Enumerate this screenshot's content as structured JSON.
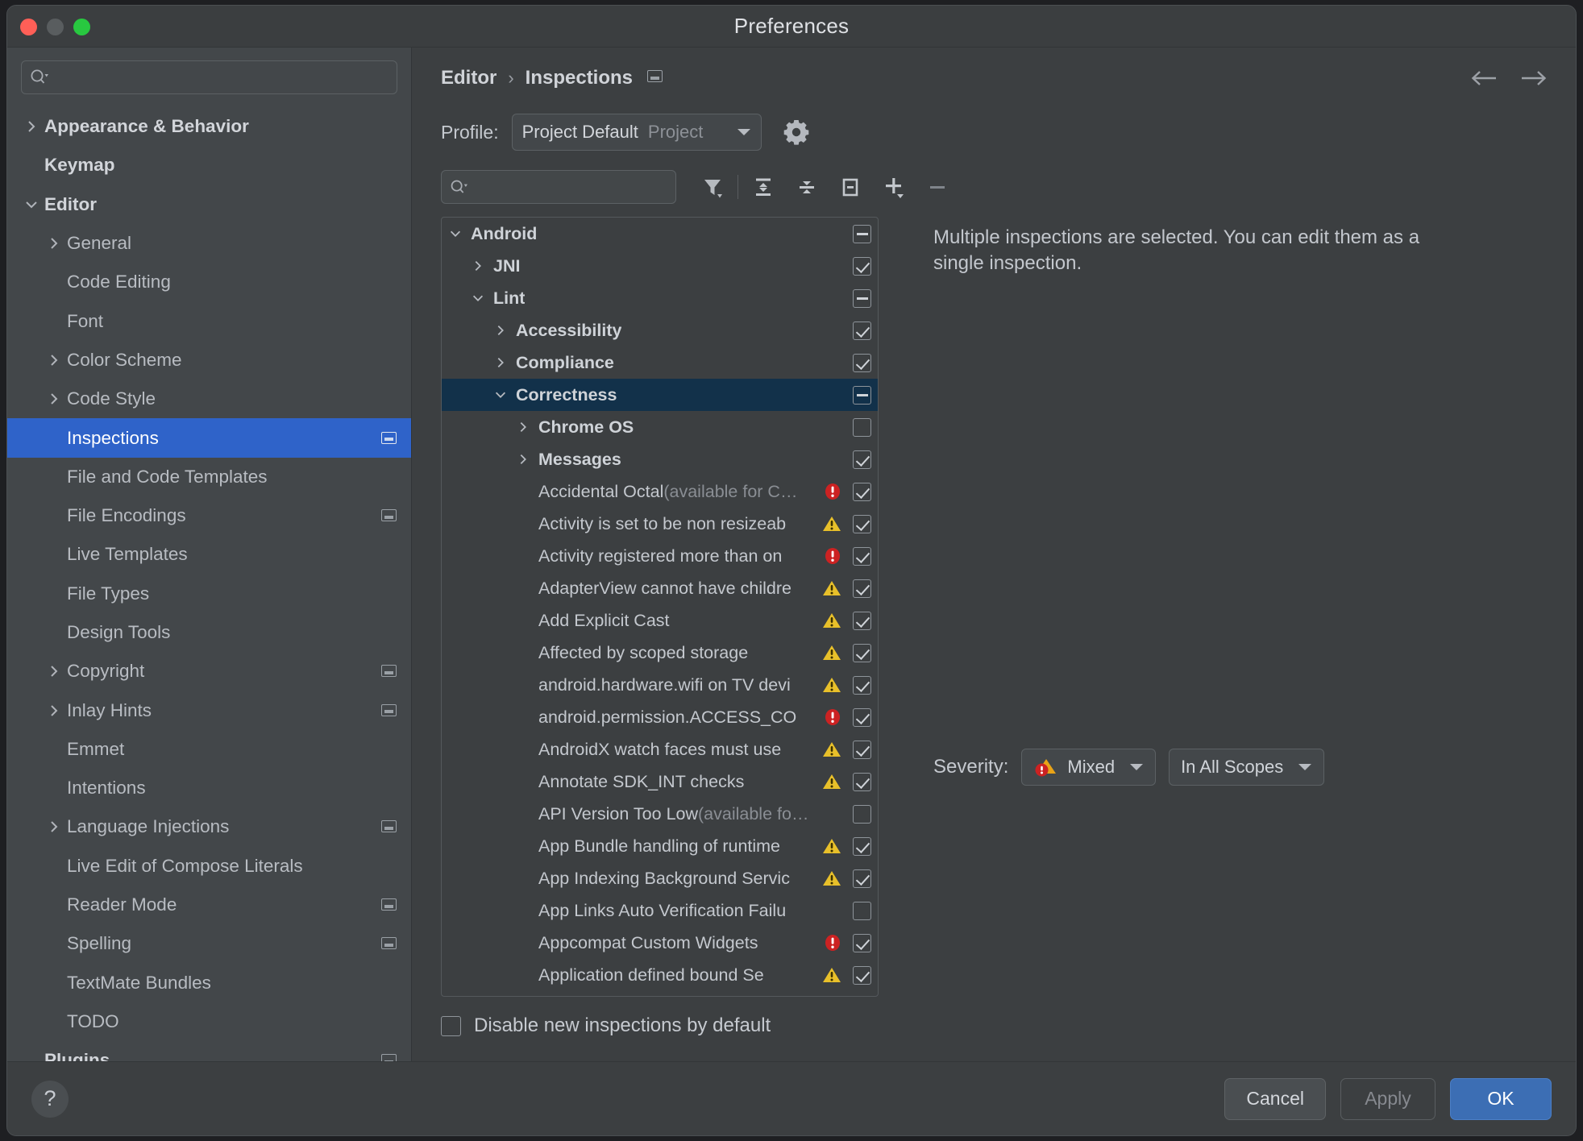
{
  "window": {
    "title": "Preferences"
  },
  "sidebar": {
    "search": {
      "placeholder": "",
      "value": "",
      "icon": "search-icon"
    },
    "items": [
      {
        "label": "Appearance & Behavior",
        "level": 0,
        "chevron": "chevron-right",
        "selected": false,
        "badge": false
      },
      {
        "label": "Keymap",
        "level": 0,
        "chevron": "",
        "selected": false,
        "badge": false
      },
      {
        "label": "Editor",
        "level": 0,
        "chevron": "chevron-down",
        "selected": false,
        "badge": false
      },
      {
        "label": "General",
        "level": 1,
        "chevron": "chevron-right",
        "selected": false,
        "badge": false
      },
      {
        "label": "Code Editing",
        "level": 1,
        "chevron": "",
        "selected": false,
        "badge": false
      },
      {
        "label": "Font",
        "level": 1,
        "chevron": "",
        "selected": false,
        "badge": false
      },
      {
        "label": "Color Scheme",
        "level": 1,
        "chevron": "chevron-right",
        "selected": false,
        "badge": false
      },
      {
        "label": "Code Style",
        "level": 1,
        "chevron": "chevron-right",
        "selected": false,
        "badge": false
      },
      {
        "label": "Inspections",
        "level": 1,
        "chevron": "",
        "selected": true,
        "badge": true
      },
      {
        "label": "File and Code Templates",
        "level": 1,
        "chevron": "",
        "selected": false,
        "badge": false
      },
      {
        "label": "File Encodings",
        "level": 1,
        "chevron": "",
        "selected": false,
        "badge": true
      },
      {
        "label": "Live Templates",
        "level": 1,
        "chevron": "",
        "selected": false,
        "badge": false
      },
      {
        "label": "File Types",
        "level": 1,
        "chevron": "",
        "selected": false,
        "badge": false
      },
      {
        "label": "Design Tools",
        "level": 1,
        "chevron": "",
        "selected": false,
        "badge": false
      },
      {
        "label": "Copyright",
        "level": 1,
        "chevron": "chevron-right",
        "selected": false,
        "badge": true
      },
      {
        "label": "Inlay Hints",
        "level": 1,
        "chevron": "chevron-right",
        "selected": false,
        "badge": true
      },
      {
        "label": "Emmet",
        "level": 1,
        "chevron": "",
        "selected": false,
        "badge": false
      },
      {
        "label": "Intentions",
        "level": 1,
        "chevron": "",
        "selected": false,
        "badge": false
      },
      {
        "label": "Language Injections",
        "level": 1,
        "chevron": "chevron-right",
        "selected": false,
        "badge": true
      },
      {
        "label": "Live Edit of Compose Literals",
        "level": 1,
        "chevron": "",
        "selected": false,
        "badge": false
      },
      {
        "label": "Reader Mode",
        "level": 1,
        "chevron": "",
        "selected": false,
        "badge": true
      },
      {
        "label": "Spelling",
        "level": 1,
        "chevron": "",
        "selected": false,
        "badge": true
      },
      {
        "label": "TextMate Bundles",
        "level": 1,
        "chevron": "",
        "selected": false,
        "badge": false
      },
      {
        "label": "TODO",
        "level": 1,
        "chevron": "",
        "selected": false,
        "badge": false
      },
      {
        "label": "Plugins",
        "level": 0,
        "chevron": "",
        "selected": false,
        "badge": true
      }
    ]
  },
  "header": {
    "breadcrumb": {
      "parent": "Editor",
      "separator": "›",
      "current": "Inspections",
      "badge_icon": "copy-settings-icon"
    },
    "nav_back_icon": "arrow-left-icon",
    "nav_forward_icon": "arrow-right-icon"
  },
  "profile": {
    "label": "Profile:",
    "value": "Project Default",
    "scope": "Project",
    "caret_icon": "chevron-down-icon",
    "gear_icon": "gear-icon"
  },
  "toolbar": {
    "search": {
      "placeholder": "",
      "value": "",
      "icon": "search-icon"
    },
    "buttons": [
      {
        "name": "filter-icon",
        "title": "Filter inspections"
      },
      {
        "name": "expand-all-icon",
        "title": "Expand All"
      },
      {
        "name": "collapse-all-icon",
        "title": "Collapse All"
      },
      {
        "name": "reset-to-empty-icon",
        "title": "Reset To Empty"
      },
      {
        "name": "add-icon",
        "title": "Add"
      },
      {
        "name": "remove-icon",
        "title": "Remove"
      }
    ]
  },
  "tree": {
    "rows": [
      {
        "label": "Android",
        "suffix": "",
        "indent": 0,
        "chevron": "chevron-down",
        "group": true,
        "check": "partial",
        "severity": "",
        "selected": false
      },
      {
        "label": "JNI",
        "suffix": "",
        "indent": 1,
        "chevron": "chevron-right",
        "group": true,
        "check": "checked",
        "severity": "",
        "selected": false
      },
      {
        "label": "Lint",
        "suffix": "",
        "indent": 1,
        "chevron": "chevron-down",
        "group": true,
        "check": "partial",
        "severity": "",
        "selected": false
      },
      {
        "label": "Accessibility",
        "suffix": "",
        "indent": 2,
        "chevron": "chevron-right",
        "group": true,
        "check": "checked",
        "severity": "",
        "selected": false
      },
      {
        "label": "Compliance",
        "suffix": "",
        "indent": 2,
        "chevron": "chevron-right",
        "group": true,
        "check": "checked",
        "severity": "",
        "selected": false
      },
      {
        "label": "Correctness",
        "suffix": "",
        "indent": 2,
        "chevron": "chevron-down",
        "group": true,
        "check": "partial",
        "severity": "",
        "selected": true
      },
      {
        "label": "Chrome OS",
        "suffix": "",
        "indent": 3,
        "chevron": "chevron-right",
        "group": true,
        "check": "empty",
        "severity": "",
        "selected": false
      },
      {
        "label": "Messages",
        "suffix": "",
        "indent": 3,
        "chevron": "chevron-right",
        "group": true,
        "check": "checked",
        "severity": "",
        "selected": false
      },
      {
        "label": "Accidental Octal",
        "suffix": " (available for C…",
        "indent": 4,
        "chevron": "",
        "group": false,
        "check": "checked",
        "severity": "error",
        "selected": false
      },
      {
        "label": "Activity is set to be non resizeab",
        "suffix": "",
        "indent": 4,
        "chevron": "",
        "group": false,
        "check": "checked",
        "severity": "warning",
        "selected": false
      },
      {
        "label": "Activity registered more than on",
        "suffix": "",
        "indent": 4,
        "chevron": "",
        "group": false,
        "check": "checked",
        "severity": "error",
        "selected": false
      },
      {
        "label": "AdapterView cannot have childre",
        "suffix": "",
        "indent": 4,
        "chevron": "",
        "group": false,
        "check": "checked",
        "severity": "warning",
        "selected": false
      },
      {
        "label": "Add Explicit Cast",
        "suffix": "",
        "indent": 4,
        "chevron": "",
        "group": false,
        "check": "checked",
        "severity": "warning",
        "selected": false
      },
      {
        "label": "Affected by scoped storage",
        "suffix": "",
        "indent": 4,
        "chevron": "",
        "group": false,
        "check": "checked",
        "severity": "warning",
        "selected": false
      },
      {
        "label": "android.hardware.wifi on TV devi",
        "suffix": "",
        "indent": 4,
        "chevron": "",
        "group": false,
        "check": "checked",
        "severity": "warning",
        "selected": false
      },
      {
        "label": "android.permission.ACCESS_CO",
        "suffix": "",
        "indent": 4,
        "chevron": "",
        "group": false,
        "check": "checked",
        "severity": "error",
        "selected": false
      },
      {
        "label": "AndroidX watch faces must use ",
        "suffix": "",
        "indent": 4,
        "chevron": "",
        "group": false,
        "check": "checked",
        "severity": "warning",
        "selected": false
      },
      {
        "label": "Annotate SDK_INT checks",
        "suffix": "",
        "indent": 4,
        "chevron": "",
        "group": false,
        "check": "checked",
        "severity": "warning",
        "selected": false
      },
      {
        "label": "API Version Too Low",
        "suffix": " (available fo…",
        "indent": 4,
        "chevron": "",
        "group": false,
        "check": "empty",
        "severity": "",
        "selected": false
      },
      {
        "label": "App Bundle handling of runtime ",
        "suffix": "",
        "indent": 4,
        "chevron": "",
        "group": false,
        "check": "checked",
        "severity": "warning",
        "selected": false
      },
      {
        "label": "App Indexing Background Servic",
        "suffix": "",
        "indent": 4,
        "chevron": "",
        "group": false,
        "check": "checked",
        "severity": "warning",
        "selected": false
      },
      {
        "label": "App Links Auto Verification Failu",
        "suffix": "",
        "indent": 4,
        "chevron": "",
        "group": false,
        "check": "empty",
        "severity": "",
        "selected": false
      },
      {
        "label": "Appcompat Custom Widgets",
        "suffix": "",
        "indent": 4,
        "chevron": "",
        "group": false,
        "check": "checked",
        "severity": "error",
        "selected": false
      },
      {
        "label": "Application defined bound Se",
        "suffix": "",
        "indent": 4,
        "chevron": "",
        "group": false,
        "check": "checked",
        "severity": "warning",
        "selected": false
      }
    ]
  },
  "detail": {
    "message": "Multiple inspections are selected. You can edit them as a single inspection.",
    "severity_label": "Severity:",
    "severity_value": "Mixed",
    "severity_icon": "mixed-severity-icon",
    "scope_value": "In All Scopes",
    "caret_icon": "chevron-down-icon"
  },
  "bottom": {
    "disable_new_label": "Disable new inspections by default",
    "disable_new_checked": false
  },
  "footer": {
    "help_label": "?",
    "cancel_label": "Cancel",
    "apply_label": "Apply",
    "ok_label": "OK"
  },
  "colors": {
    "accent_blue": "#2f63c9",
    "ok_button": "#3c6eb4",
    "tree_selection": "#12314a",
    "error_red": "#cc2222",
    "warning_yellow": "#e8c02a",
    "window_bg": "#3c3f41",
    "sidebar_bg": "#43474a"
  }
}
